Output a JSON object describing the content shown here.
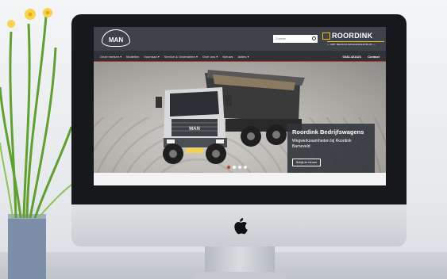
{
  "site": {
    "search_placeholder": "Zoeken",
    "brand_name": "ROORDINK",
    "brand_tagline": "— HÉT BEDRIJFSWAGENCENTRUM —",
    "man_logo": "MAN"
  },
  "nav": {
    "items": [
      "Onze merken ▾",
      "Modellen",
      "Voorraad ▾",
      "Service & Onderdelen ▾",
      "Over ons ▾",
      "Nieuws",
      "Acties ▾"
    ],
    "phone": "0342-421421",
    "contact": "Contact"
  },
  "hero": {
    "title": "Roordink Bedrijfswagens",
    "subtitle": "Wegwerkzaamheden bij Roordink Barneveld",
    "button": "Bekijk de nieuws",
    "slide_count": 4,
    "active_slide": 1
  },
  "colors": {
    "header": "#3f4349",
    "nav": "#2f3237",
    "accent": "#c0392b",
    "brand_yellow": "#f2b824"
  },
  "icons": [
    "search-icon",
    "apple-logo-icon",
    "roordink-logo-icon",
    "man-logo-icon"
  ]
}
